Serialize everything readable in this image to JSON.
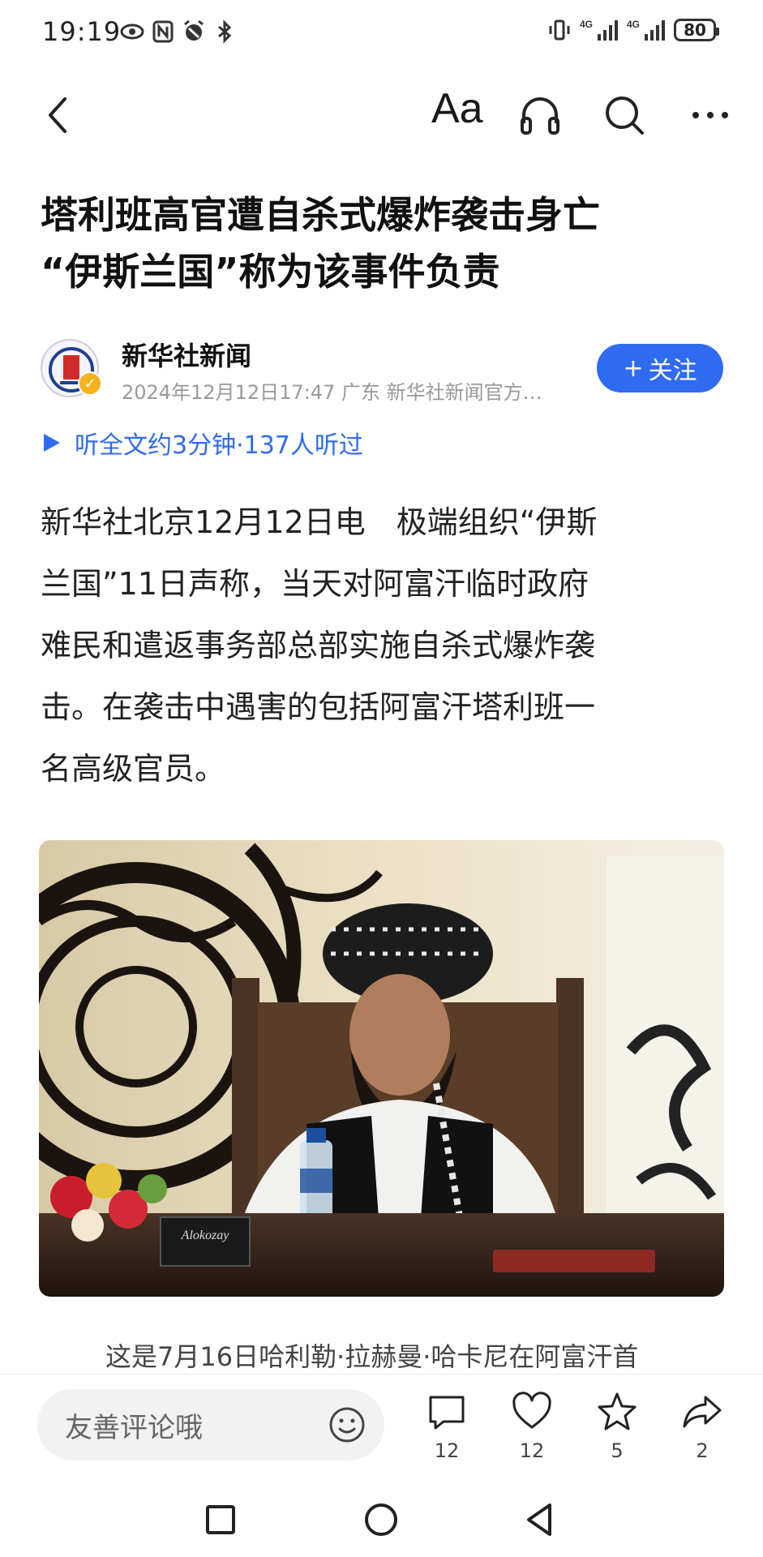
{
  "status_bar": {
    "time": "19:19",
    "battery": "80",
    "network_1": "4G",
    "network_2": "4G"
  },
  "top_nav": {
    "font_size_label": "Aa"
  },
  "article": {
    "title_line1": "塔利班高官遭自杀式爆炸袭击身亡",
    "title_line2": "“伊斯兰国”称为该事件负责",
    "author": "新华社新闻",
    "meta": "2024年12月12日17:47 广东 新华社新闻官方…",
    "follow_label": "关注",
    "listen_text": "听全文约3分钟·137人听过",
    "body": "新华社北京12月12日电　极端组织“伊斯\n兰国”11日声称，当天对阿富汗临时政府\n难民和遣返事务部总部实施自杀式爆炸袭\n击。在袭击中遇害的包括阿富汗塔利班一\n名高级官员。",
    "image_nameplate": "Alokozay",
    "caption": "这是7月16日哈利勒·拉赫曼·哈卡尼在阿富汗首"
  },
  "bottom_bar": {
    "comment_placeholder": "友善评论哦",
    "comment_count": "12",
    "like_count": "12",
    "favorite_count": "5",
    "share_count": "2"
  },
  "colors": {
    "accent": "#2f6bf0",
    "badge": "#f5b31b"
  }
}
